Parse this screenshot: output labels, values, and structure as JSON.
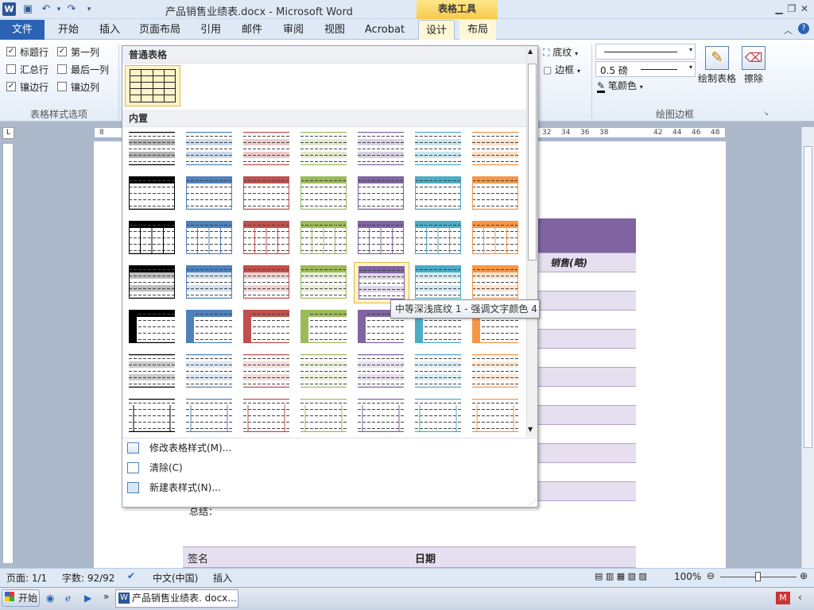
{
  "titlebar": {
    "app_icon": "W",
    "title": "产品销售业绩表.docx - Microsoft Word",
    "contextual_group": "表格工具",
    "quick_access": [
      "save-icon",
      "undo-icon",
      "redo-icon",
      "customize-icon"
    ]
  },
  "tabs": [
    {
      "label": "文件"
    },
    {
      "label": "开始"
    },
    {
      "label": "插入"
    },
    {
      "label": "页面布局"
    },
    {
      "label": "引用"
    },
    {
      "label": "邮件"
    },
    {
      "label": "审阅"
    },
    {
      "label": "视图"
    },
    {
      "label": "Acrobat"
    },
    {
      "label": "设计"
    },
    {
      "label": "布局"
    }
  ],
  "ribbon": {
    "style_options": {
      "header_row": "标题行",
      "first_column": "第一列",
      "total_row": "汇总行",
      "last_column": "最后一列",
      "banded_rows": "镶边行",
      "banded_columns": "镶边列",
      "group_label": "表格样式选项"
    },
    "shading": "底纹",
    "borders": "边框",
    "pen_weight": "0.5 磅",
    "pen_color": "笔颜色",
    "draw_table": "绘制表格",
    "eraser": "擦除",
    "draw_group_label": "绘图边框"
  },
  "ruler": {
    "ticks": [
      "8",
      "32",
      "34",
      "36",
      "38",
      "42",
      "44",
      "46",
      "48"
    ]
  },
  "gallery": {
    "section_plain": "普通表格",
    "section_builtin": "内置",
    "theme_colors": [
      "#000000",
      "#4f81bd",
      "#c0504d",
      "#9bbb59",
      "#8064a2",
      "#4bacc6",
      "#f79646"
    ],
    "menu": [
      {
        "label": "修改表格样式(M)..."
      },
      {
        "label": "清除(C)"
      },
      {
        "label": "新建表样式(N)..."
      }
    ],
    "tooltip": "中等深浅底纹 1 - 强调文字颜色 4"
  },
  "document": {
    "header_cell": "销售(略)",
    "summary_label": "总结：",
    "signature_label": "签名",
    "date_label": "日期",
    "accent": "#8064a2",
    "band": "#e5dff0"
  },
  "status": {
    "page": "页面: 1/1",
    "words": "字数: 92/92",
    "language": "中文(中国)",
    "mode": "插入",
    "zoom": "100%"
  },
  "taskbar": {
    "start": "开始",
    "task": "产品销售业绩表. docx..."
  }
}
